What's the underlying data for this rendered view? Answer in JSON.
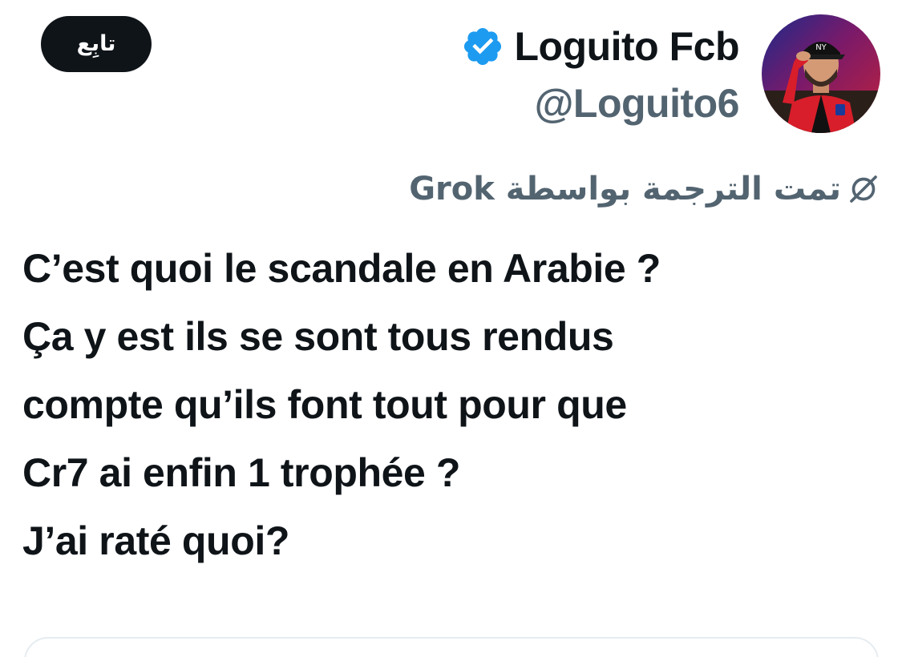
{
  "tweet": {
    "follow_label": "تابِع",
    "author": {
      "display_name": "Loguito Fcb",
      "handle": "@Loguito6",
      "verified": true,
      "verified_color": "#1d9bf0"
    },
    "translation_note": "تمت الترجمة بواسطة Grok",
    "translation_icon": "grok-icon",
    "text_lines": [
      "C’est quoi le scandale en Arabie ?",
      "Ça y est ils se sont tous rendus",
      "compte qu’ils font tout pour que",
      "Cr7 ai enfin 1 trophée ?",
      "J’ai raté quoi?"
    ]
  },
  "colors": {
    "text_primary": "#0f1419",
    "text_secondary": "#536471",
    "follow_bg": "#0f1419",
    "follow_text": "#ffffff"
  }
}
